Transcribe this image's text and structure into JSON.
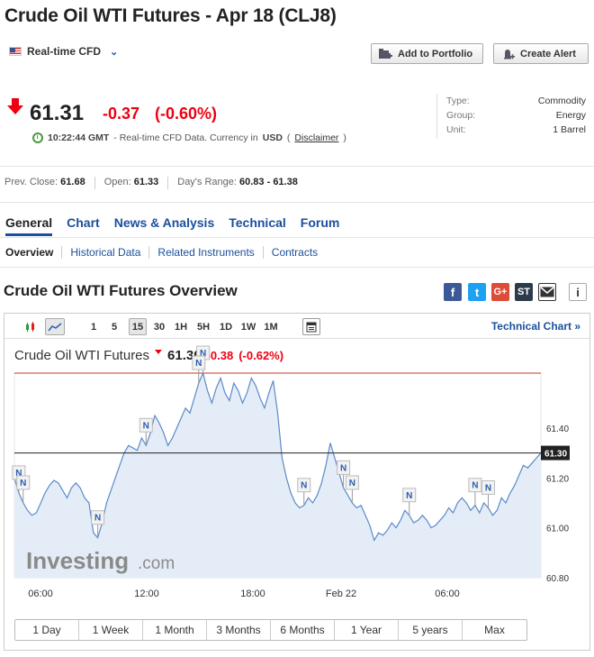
{
  "header": {
    "title": "Crude Oil WTI Futures - Apr 18 (CLJ8)",
    "cfd_label": "Real-time CFD",
    "add_portfolio": "Add to Portfolio",
    "create_alert": "Create Alert"
  },
  "quote": {
    "last": "61.31",
    "change": "-0.37",
    "change_pct": "(-0.60%)",
    "time": "10:22:44 GMT",
    "note_prefix": "- Real-time CFD Data. Currency in",
    "currency": "USD",
    "disclaimer": "Disclaimer",
    "open_paren": "(",
    "close_paren": ")"
  },
  "info": {
    "type_k": "Type:",
    "type_v": "Commodity",
    "group_k": "Group:",
    "group_v": "Energy",
    "unit_k": "Unit:",
    "unit_v": "1 Barrel"
  },
  "stats": {
    "prev_close_k": "Prev. Close:",
    "prev_close_v": "61.68",
    "open_k": "Open:",
    "open_v": "61.33",
    "range_k": "Day's Range:",
    "range_v": "60.83 - 61.38"
  },
  "tabs": [
    "General",
    "Chart",
    "News & Analysis",
    "Technical",
    "Forum"
  ],
  "subtabs": [
    "Overview",
    "Historical Data",
    "Related Instruments",
    "Contracts"
  ],
  "section_title": "Crude Oil WTI Futures Overview",
  "social": {
    "facebook": "f",
    "twitter": "t",
    "gplus": "G+",
    "stocktwits": "ST",
    "info": "i"
  },
  "chart_toolbar": {
    "intervals": [
      "1",
      "5",
      "15",
      "30",
      "1H",
      "5H",
      "1D",
      "1W",
      "1M"
    ],
    "selected": "15",
    "technical_chart": "Technical Chart »"
  },
  "chart_header": {
    "name": "Crude Oil WTI Futures",
    "price": "61.30",
    "change": "-0.38",
    "change_pct": "(-0.62%)"
  },
  "watermark": {
    "brand": "Investing",
    "suffix": ".com"
  },
  "range_buttons": [
    "1 Day",
    "1 Week",
    "1 Month",
    "3 Months",
    "6 Months",
    "1 Year",
    "5 years",
    "Max"
  ],
  "colors": {
    "down": "#ee1111",
    "link": "#1a4f9c",
    "line": "#5b8ac7",
    "area": "#e4edf7"
  },
  "chart_data": {
    "type": "area",
    "title": "Crude Oil WTI Futures",
    "x_tick_labels": [
      "06:00",
      "12:00",
      "18:00",
      "Feb 22",
      "06:00"
    ],
    "y_tick_labels": [
      "61.40",
      "61.20",
      "61.00",
      "60.80"
    ],
    "ylim": [
      60.8,
      61.62
    ],
    "current_price": "61.30",
    "reference_line": 61.3,
    "high_line": 61.62,
    "x": [
      0,
      1,
      2,
      3,
      4,
      5,
      6,
      7,
      8,
      9,
      10,
      11,
      12,
      13,
      14,
      15,
      16,
      17,
      18,
      19,
      20,
      21,
      22,
      23,
      24,
      25,
      26,
      27,
      28,
      29,
      30,
      31,
      32,
      33,
      34,
      35,
      36,
      37,
      38,
      39,
      40,
      41,
      42,
      43,
      44,
      45,
      46,
      47,
      48,
      49,
      50,
      51,
      52,
      53,
      54,
      55,
      56,
      57,
      58,
      59,
      60,
      61,
      62,
      63,
      64,
      65,
      66,
      67,
      68,
      69,
      70,
      71,
      72,
      73,
      74,
      75,
      76,
      77,
      78,
      79,
      80,
      81,
      82,
      83,
      84,
      85,
      86,
      87,
      88,
      89,
      90,
      91,
      92,
      93,
      94,
      95,
      96,
      97,
      98,
      99,
      100,
      101,
      102,
      103,
      104,
      105,
      106,
      107,
      108,
      109,
      110,
      111,
      112,
      113,
      114,
      115,
      116,
      117,
      118,
      119,
      120
    ],
    "values": [
      61.2,
      61.14,
      61.1,
      61.07,
      61.05,
      61.06,
      61.1,
      61.14,
      61.17,
      61.19,
      61.18,
      61.15,
      61.12,
      61.16,
      61.18,
      61.16,
      61.12,
      61.1,
      60.98,
      60.96,
      61.02,
      61.1,
      61.15,
      61.2,
      61.25,
      61.3,
      61.33,
      61.32,
      61.31,
      61.36,
      61.33,
      61.38,
      61.45,
      61.42,
      61.38,
      61.33,
      61.36,
      61.4,
      61.44,
      61.48,
      61.46,
      61.52,
      61.58,
      61.62,
      61.55,
      61.5,
      61.56,
      61.6,
      61.54,
      61.51,
      61.58,
      61.55,
      61.5,
      61.54,
      61.6,
      61.57,
      61.52,
      61.48,
      61.54,
      61.59,
      61.46,
      61.28,
      61.2,
      61.14,
      61.1,
      61.08,
      61.09,
      61.12,
      61.1,
      61.13,
      61.18,
      61.25,
      61.34,
      61.28,
      61.22,
      61.16,
      61.13,
      61.1,
      61.08,
      61.09,
      61.05,
      61.01,
      60.95,
      60.98,
      60.97,
      60.99,
      61.02,
      61.0,
      61.03,
      61.07,
      61.05,
      61.02,
      61.03,
      61.05,
      61.03,
      61.0,
      61.01,
      61.03,
      61.05,
      61.08,
      61.06,
      61.1,
      61.12,
      61.1,
      61.07,
      61.09,
      61.06,
      61.1,
      61.08,
      61.05,
      61.07,
      61.12,
      61.1,
      61.14,
      61.17,
      61.21,
      61.25,
      61.24,
      61.26,
      61.28,
      61.3
    ],
    "news_markers": [
      {
        "x": 1,
        "label": "N"
      },
      {
        "x": 2,
        "label": "N"
      },
      {
        "x": 19,
        "label": "N"
      },
      {
        "x": 30,
        "label": "N"
      },
      {
        "x": 43,
        "label": "N"
      },
      {
        "x": 42,
        "label": "N"
      },
      {
        "x": 66,
        "label": "N"
      },
      {
        "x": 75,
        "label": "N"
      },
      {
        "x": 77,
        "label": "N"
      },
      {
        "x": 90,
        "label": "N"
      },
      {
        "x": 105,
        "label": "N"
      },
      {
        "x": 108,
        "label": "N"
      }
    ],
    "grid": false
  }
}
